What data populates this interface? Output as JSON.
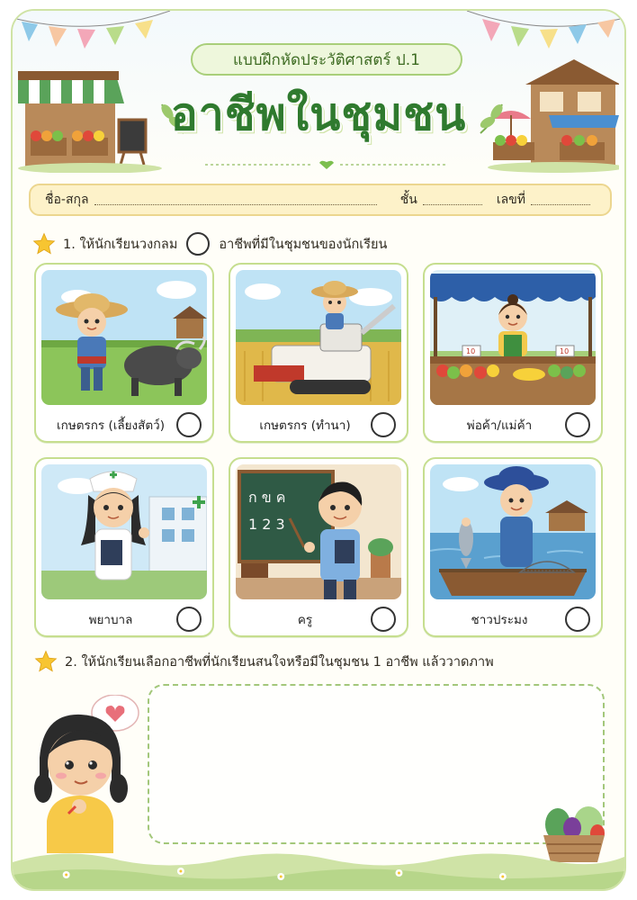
{
  "header": {
    "subtitle": "แบบฝึกหัดประวัติศาสตร์ ป.1",
    "title": "อาชีพในชุมชน"
  },
  "student_info": {
    "name_label": "ชื่อ-สกุล",
    "class_label": "ชั้น",
    "number_label": "เลขที่"
  },
  "question1": {
    "text_before": "1. ให้นักเรียนวงกลม",
    "text_after": "อาชีพที่มีในชุมชนของนักเรียน"
  },
  "occupations": [
    {
      "label": "เกษตรกร (เลี้ยงสัตว์)",
      "icon": "farmer-buffalo-illustration"
    },
    {
      "label": "เกษตรกร (ทำนา)",
      "icon": "farmer-harvester-illustration"
    },
    {
      "label": "พ่อค้า/แม่ค้า",
      "icon": "vendor-market-illustration"
    },
    {
      "label": "พยาบาล",
      "icon": "nurse-illustration"
    },
    {
      "label": "ครู",
      "icon": "teacher-illustration"
    },
    {
      "label": "ชาวประมง",
      "icon": "fisherman-illustration"
    }
  ],
  "scene_text": {
    "chalkboard_line1": "ก ข ค",
    "chalkboard_line2": "1 2 3",
    "price_tag_1": "10",
    "price_tag_2": "10"
  },
  "question2": {
    "text": "2. ให้นักเรียนเลือกอาชีพที่นักเรียนสนใจหรือมีในชุมชน 1 อาชีพ แล้ววาดภาพ"
  },
  "colors": {
    "title_green": "#2f7a2e",
    "border_green": "#c6de8f",
    "name_bar_yellow": "#fdf2c9",
    "star_yellow": "#f7c531"
  }
}
